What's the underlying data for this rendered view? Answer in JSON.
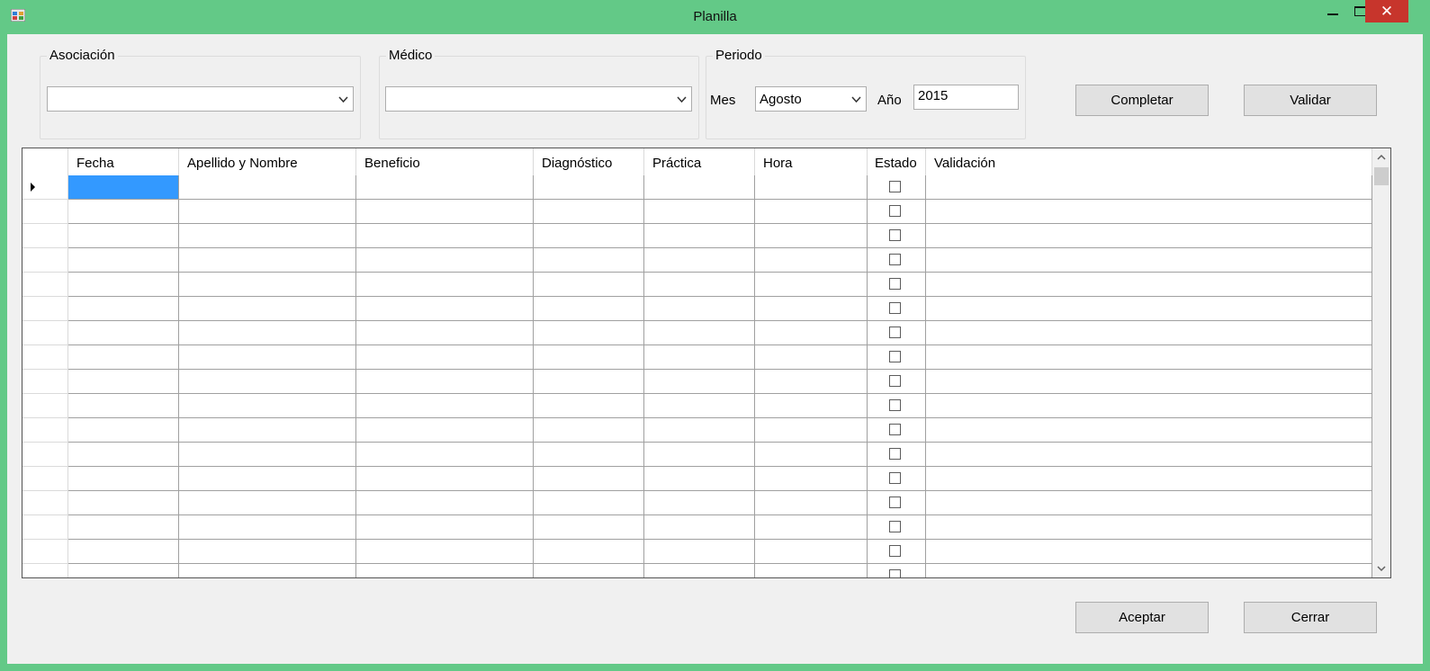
{
  "window": {
    "title": "Planilla",
    "close_glyph": "✕",
    "colors": {
      "frame": "#63c987",
      "close": "#c7352c",
      "selection": "#3399ff"
    }
  },
  "filters": {
    "asociacion": {
      "legend": "Asociación",
      "value": ""
    },
    "medico": {
      "legend": "Médico",
      "value": ""
    },
    "periodo": {
      "legend": "Periodo",
      "mes_label": "Mes",
      "mes_value": "Agosto",
      "anio_label": "Año",
      "anio_value": "2015"
    }
  },
  "buttons": {
    "completar": "Completar",
    "validar": "Validar",
    "aceptar": "Aceptar",
    "cerrar": "Cerrar"
  },
  "grid": {
    "columns": [
      "Fecha",
      "Apellido y Nombre",
      "Beneficio",
      "Diagnóstico",
      "Práctica",
      "Hora",
      "Estado",
      "Validación"
    ],
    "rows": [
      {
        "checked": false
      },
      {
        "checked": false
      },
      {
        "checked": false
      },
      {
        "checked": false
      },
      {
        "checked": false
      },
      {
        "checked": false
      },
      {
        "checked": false
      },
      {
        "checked": false
      },
      {
        "checked": false
      },
      {
        "checked": false
      },
      {
        "checked": false
      },
      {
        "checked": false
      },
      {
        "checked": false
      },
      {
        "checked": false
      },
      {
        "checked": false
      },
      {
        "checked": false
      },
      {
        "checked": false
      },
      {
        "checked": false
      }
    ],
    "selected_row": 0,
    "selected_column": "Fecha"
  },
  "icons": {
    "app": "app-icon",
    "minimize": "minimize-icon",
    "maximize": "maximize-icon",
    "close": "close-icon",
    "dropdown": "chevron-down-icon",
    "scroll_up": "chevron-up-icon",
    "scroll_down": "chevron-down-icon",
    "row_pointer": "row-pointer-icon"
  }
}
